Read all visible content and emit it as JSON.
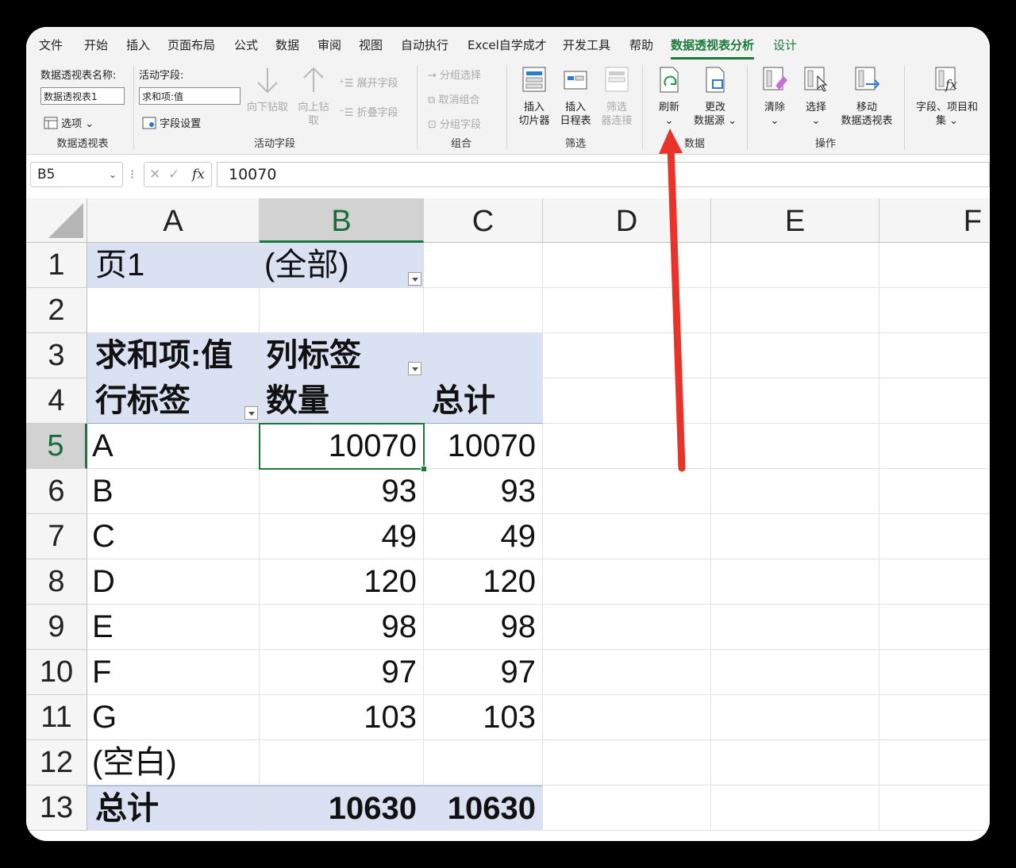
{
  "tabs": [
    "文件",
    "开始",
    "插入",
    "页面布局",
    "公式",
    "数据",
    "审阅",
    "视图",
    "自动执行",
    "Excel自学成才",
    "开发工具",
    "帮助",
    "数据透视表分析",
    "设计"
  ],
  "ribbon": {
    "pivot_name_label": "数据透视表名称:",
    "pivot_name_value": "数据透视表1",
    "options_label": "选项",
    "group_pivot": "数据透视表",
    "active_field_label": "活动字段:",
    "active_field_value": "求和项:值",
    "field_settings": "字段设置",
    "drill_down": "向下钻取",
    "drill_up_1": "向上钻",
    "drill_up_2": "取",
    "expand_field": "展开字段",
    "collapse_field": "折叠字段",
    "group_active_field": "活动字段",
    "group_selection": "分组选择",
    "ungroup": "取消组合",
    "group_field": "分组字段",
    "group_group": "组合",
    "insert_slicer_1": "插入",
    "insert_slicer_2": "切片器",
    "insert_timeline_1": "插入",
    "insert_timeline_2": "日程表",
    "filter_conn_1": "筛选",
    "filter_conn_2": "器连接",
    "group_filter": "筛选",
    "refresh": "刷新",
    "change_source_1": "更改",
    "change_source_2": "数据源",
    "group_data": "数据",
    "clear": "清除",
    "select": "选择",
    "move_pivot_1": "移动",
    "move_pivot_2": "数据透视表",
    "group_actions": "操作",
    "fields_items_1": "字段、项目和",
    "fields_items_2": "集"
  },
  "formula_bar": {
    "name_box": "B5",
    "value": "10070",
    "fx": "fx"
  },
  "columns": [
    "A",
    "B",
    "C",
    "D",
    "E",
    "F"
  ],
  "rows": [
    "1",
    "2",
    "3",
    "4",
    "5",
    "6",
    "7",
    "8",
    "9",
    "10",
    "11",
    "12",
    "13"
  ],
  "pivot": {
    "page_field": "页1",
    "page_value": "(全部)",
    "sum_label": "求和项:值",
    "col_labels": "列标签",
    "row_labels": "行标签",
    "qty_header": "数量",
    "total_header": "总计",
    "data": [
      {
        "label": "A",
        "qty": "10070",
        "total": "10070"
      },
      {
        "label": "B",
        "qty": "93",
        "total": "93"
      },
      {
        "label": "C",
        "qty": "49",
        "total": "49"
      },
      {
        "label": "D",
        "qty": "120",
        "total": "120"
      },
      {
        "label": "E",
        "qty": "98",
        "total": "98"
      },
      {
        "label": "F",
        "qty": "97",
        "total": "97"
      },
      {
        "label": "G",
        "qty": "103",
        "total": "103"
      },
      {
        "label": "(空白)",
        "qty": "",
        "total": ""
      }
    ],
    "grand_label": "总计",
    "grand_qty": "10630",
    "grand_total": "10630"
  },
  "annotation": {
    "arrow_color": "#e8332a"
  }
}
